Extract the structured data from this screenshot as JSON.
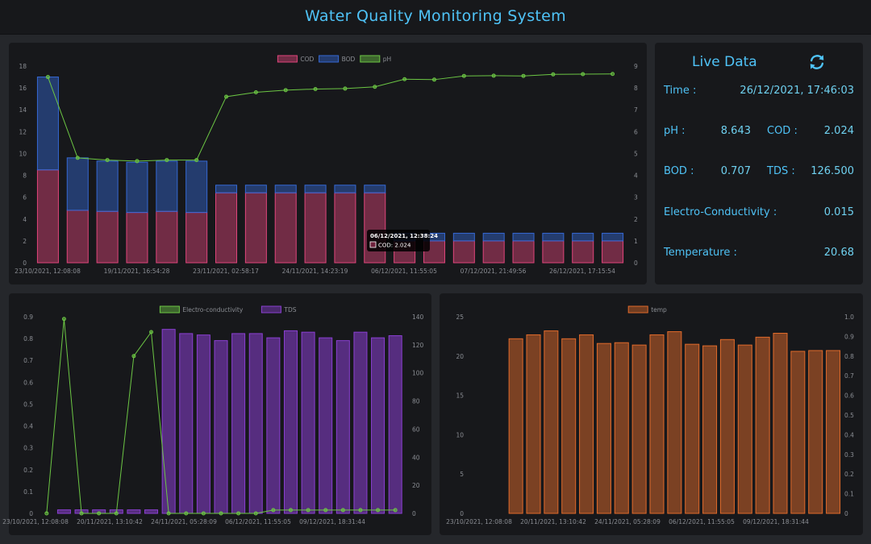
{
  "app": {
    "title": "Water Quality Monitoring System"
  },
  "live": {
    "title": "Live Data",
    "time_label": "Time :",
    "time_value": "26/12/2021, 17:46:03",
    "ph_label": "pH :",
    "ph_value": "8.643",
    "cod_label": "COD :",
    "cod_value": "2.024",
    "bod_label": "BOD :",
    "bod_value": "0.707",
    "tds_label": "TDS :",
    "tds_value": "126.500",
    "ec_label": "Electro-Conductivity :",
    "ec_value": "0.015",
    "temp_label": "Temperature :",
    "temp_value": "20.68",
    "refresh_icon": "refresh-icon"
  },
  "colors": {
    "cod": "#e0457b",
    "bod": "#3568d4",
    "ph": "#6cc644",
    "ec": "#6cc644",
    "tds": "#8a3fd1",
    "temp": "#e06a2b",
    "accent": "#4fc3f7"
  },
  "chart_data": [
    {
      "type": "bar",
      "stacked": true,
      "legend": [
        "COD",
        "BOD",
        "pH"
      ],
      "x_tick_labels": [
        "23/10/2021, 12:08:08",
        "19/11/2021, 16:54:28",
        "23/11/2021, 02:58:17",
        "24/11/2021, 14:23:19",
        "06/12/2021, 11:55:05",
        "07/12/2021, 21:49:56",
        "26/12/2021, 17:15:54"
      ],
      "series": [
        {
          "name": "COD",
          "axis": "left",
          "values": [
            8.5,
            4.8,
            4.7,
            4.6,
            4.7,
            4.6,
            6.4,
            6.4,
            6.4,
            6.4,
            6.4,
            6.4,
            2.0,
            2.0,
            2.0,
            2.0,
            2.0,
            2.0,
            2.0,
            2.0
          ]
        },
        {
          "name": "BOD",
          "axis": "left",
          "values": [
            8.5,
            4.8,
            4.6,
            4.6,
            4.6,
            4.7,
            0.7,
            0.7,
            0.7,
            0.7,
            0.7,
            0.7,
            0.7,
            0.7,
            0.7,
            0.7,
            0.7,
            0.7,
            0.7,
            0.7
          ]
        },
        {
          "name": "pH",
          "axis": "right",
          "type": "line",
          "values": [
            8.5,
            4.8,
            4.7,
            4.65,
            4.7,
            4.7,
            7.6,
            7.8,
            7.9,
            7.95,
            7.97,
            8.05,
            8.4,
            8.38,
            8.55,
            8.56,
            8.55,
            8.62,
            8.63,
            8.64
          ]
        }
      ],
      "left_ticks": [
        "0",
        "2",
        "4",
        "6",
        "8",
        "10",
        "12",
        "14",
        "16",
        "18"
      ],
      "right_ticks": [
        "0",
        "1",
        "2",
        "3",
        "4",
        "5",
        "6",
        "7",
        "8",
        "9"
      ],
      "ylim_left": [
        0,
        18
      ],
      "ylim_right": [
        0,
        9
      ],
      "tooltip": {
        "title": "06/12/2021, 12:38:24",
        "label": "COD: 2.024"
      }
    },
    {
      "type": "bar",
      "legend": [
        "Electro-conductivity",
        "TDS"
      ],
      "x_tick_labels": [
        "23/10/2021, 12:08:08",
        "20/11/2021, 13:10:42",
        "24/11/2021, 05:28:09",
        "06/12/2021, 11:55:05",
        "09/12/2021, 18:31:44"
      ],
      "series": [
        {
          "name": "Electro-conductivity",
          "axis": "left",
          "type": "line",
          "values": [
            0,
            0.89,
            0,
            0,
            0,
            0.72,
            0.83,
            0,
            0,
            0,
            0,
            0,
            0,
            0.015,
            0.015,
            0.015,
            0.015,
            0.015,
            0.015,
            0.015,
            0.015
          ]
        },
        {
          "name": "TDS",
          "axis": "right",
          "values": [
            2.5,
            2.5,
            2.5,
            2.5,
            2.5,
            2.5,
            131,
            128,
            127,
            123,
            128,
            128,
            125,
            130,
            129,
            125,
            123,
            129,
            125,
            126.5
          ]
        }
      ],
      "left_ticks": [
        "0",
        "0.1",
        "0.2",
        "0.3",
        "0.4",
        "0.5",
        "0.6",
        "0.7",
        "0.8",
        "0.9"
      ],
      "right_ticks": [
        "0",
        "20",
        "40",
        "60",
        "80",
        "100",
        "120",
        "140"
      ],
      "ylim_left": [
        0,
        0.9
      ],
      "ylim_right": [
        0,
        140
      ]
    },
    {
      "type": "bar",
      "legend": [
        "temp"
      ],
      "x_tick_labels": [
        "23/10/2021, 12:08:08",
        "20/11/2021, 13:10:42",
        "24/11/2021, 05:28:09",
        "06/12/2021, 11:55:05",
        "09/12/2021, 18:31:44"
      ],
      "series": [
        {
          "name": "temp",
          "axis": "left",
          "values": [
            22.2,
            22.7,
            23.2,
            22.2,
            22.7,
            21.6,
            21.7,
            21.4,
            22.7,
            23.1,
            21.5,
            21.3,
            22.1,
            21.4,
            22.4,
            22.9,
            20.6,
            20.7,
            20.7
          ]
        }
      ],
      "left_ticks": [
        "0",
        "5",
        "10",
        "15",
        "20",
        "25"
      ],
      "right_ticks": [
        "0",
        "0.1",
        "0.2",
        "0.3",
        "0.4",
        "0.5",
        "0.6",
        "0.7",
        "0.8",
        "0.9",
        "1.0"
      ],
      "ylim_left": [
        0,
        25
      ],
      "ylim_right": [
        0,
        1
      ]
    }
  ]
}
